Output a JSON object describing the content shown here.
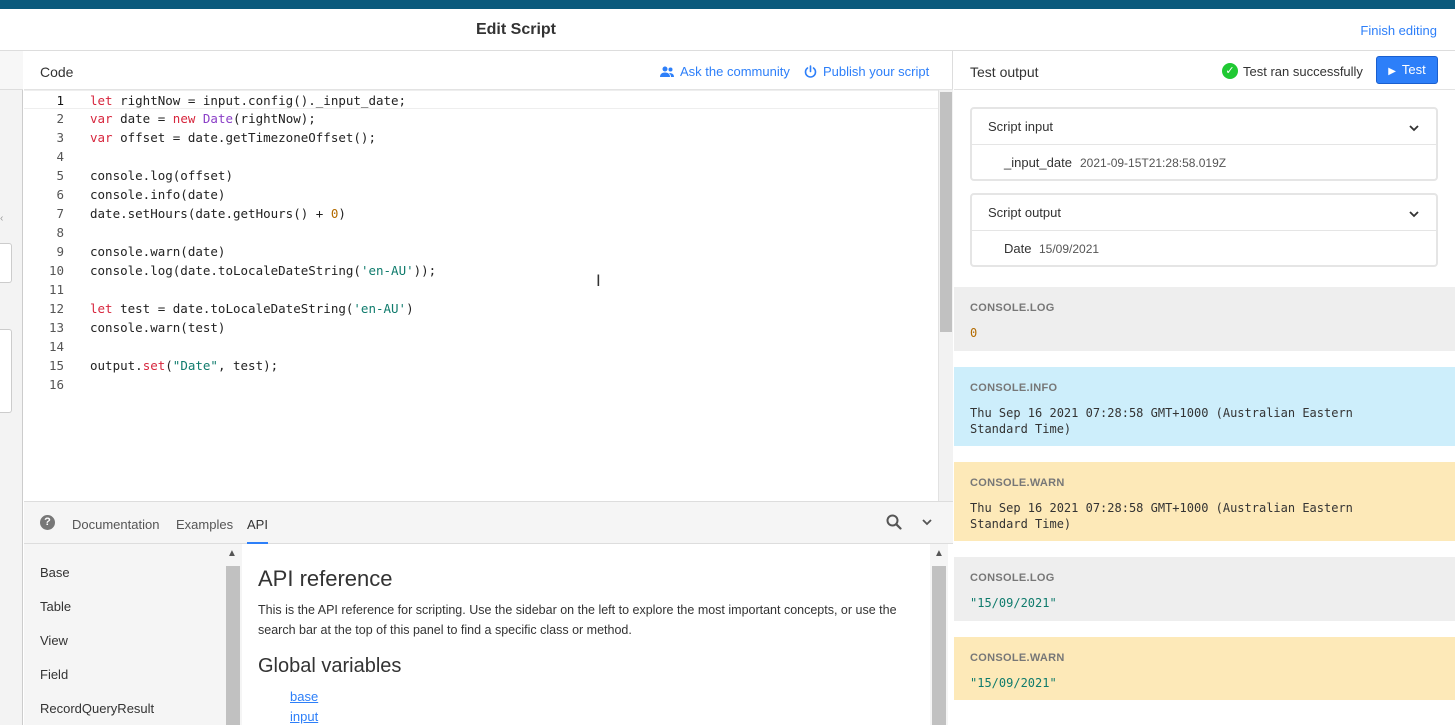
{
  "header": {
    "title": "Edit Script",
    "finish_label": "Finish editing"
  },
  "code_panel": {
    "label": "Code",
    "ask_label": "Ask the community",
    "publish_label": "Publish your script",
    "line_numbers": [
      "1",
      "2",
      "3",
      "4",
      "5",
      "6",
      "7",
      "8",
      "9",
      "10",
      "11",
      "12",
      "13",
      "14",
      "15",
      "16"
    ]
  },
  "code_lines": [
    [
      {
        "t": "let",
        "c": "kw"
      },
      {
        "t": " rightNow = input.config()._input_date;"
      }
    ],
    [
      {
        "t": "var",
        "c": "kw"
      },
      {
        "t": " date = "
      },
      {
        "t": "new",
        "c": "kw"
      },
      {
        "t": " "
      },
      {
        "t": "Date",
        "c": "cls"
      },
      {
        "t": "(rightNow);"
      }
    ],
    [
      {
        "t": "var",
        "c": "kw"
      },
      {
        "t": " offset = date.getTimezoneOffset();"
      }
    ],
    [],
    [
      {
        "t": "console.log(offset)"
      }
    ],
    [
      {
        "t": "console.info(date)"
      }
    ],
    [
      {
        "t": "date.setHours(date.getHours() + "
      },
      {
        "t": "0",
        "c": "num"
      },
      {
        "t": ")"
      }
    ],
    [],
    [
      {
        "t": "console.warn(date)"
      }
    ],
    [
      {
        "t": "console.log(date.toLocaleDateString("
      },
      {
        "t": "'en-AU'",
        "c": "str"
      },
      {
        "t": "));"
      }
    ],
    [],
    [
      {
        "t": "let",
        "c": "kw"
      },
      {
        "t": " test = date.toLocaleDateString("
      },
      {
        "t": "'en-AU'",
        "c": "str"
      },
      {
        "t": ")"
      }
    ],
    [
      {
        "t": "console.warn(test)"
      }
    ],
    [],
    [
      {
        "t": "output."
      },
      {
        "t": "set",
        "c": "fn"
      },
      {
        "t": "("
      },
      {
        "t": "\"Date\"",
        "c": "str"
      },
      {
        "t": ", test);"
      }
    ],
    []
  ],
  "docs": {
    "help_glyph": "?",
    "tabs": [
      "Documentation",
      "Examples",
      "API"
    ],
    "active_tab": "API",
    "sidebar_items": [
      "Base",
      "Table",
      "View",
      "Field",
      "RecordQueryResult"
    ],
    "heading": "API reference",
    "intro": "This is the API reference for scripting. Use the sidebar on the left to explore the most important concepts, or use the search bar at the top of this panel to find a specific class or method.",
    "subheading": "Global variables",
    "links": [
      "base",
      "input"
    ]
  },
  "test_output": {
    "label": "Test output",
    "status": "Test ran successfully",
    "test_button": "Test",
    "script_input": {
      "title": "Script input",
      "key": "_input_date",
      "value": "2021-09-15T21:28:58.019Z"
    },
    "script_output": {
      "title": "Script output",
      "key": "Date",
      "value": "15/09/2021"
    },
    "logs": [
      {
        "type": "CONSOLE.LOG",
        "value": "0"
      },
      {
        "type": "CONSOLE.INFO",
        "value": "Thu Sep 16 2021 07:28:58 GMT+1000 (Australian Eastern\nStandard Time)"
      },
      {
        "type": "CONSOLE.WARN",
        "value": "Thu Sep 16 2021 07:28:58 GMT+1000 (Australian Eastern\nStandard Time)"
      },
      {
        "type": "CONSOLE.LOG",
        "value": "\"15/09/2021\""
      },
      {
        "type": "CONSOLE.WARN",
        "value": "\"15/09/2021\""
      }
    ]
  },
  "colors": {
    "accent": "#2d7ff9",
    "top_strip": "#0b5a7c",
    "success": "#20c933",
    "log_gray": "#eeeeee",
    "info_blue": "#cdeefb",
    "warn_yellow": "#fde9b8"
  }
}
